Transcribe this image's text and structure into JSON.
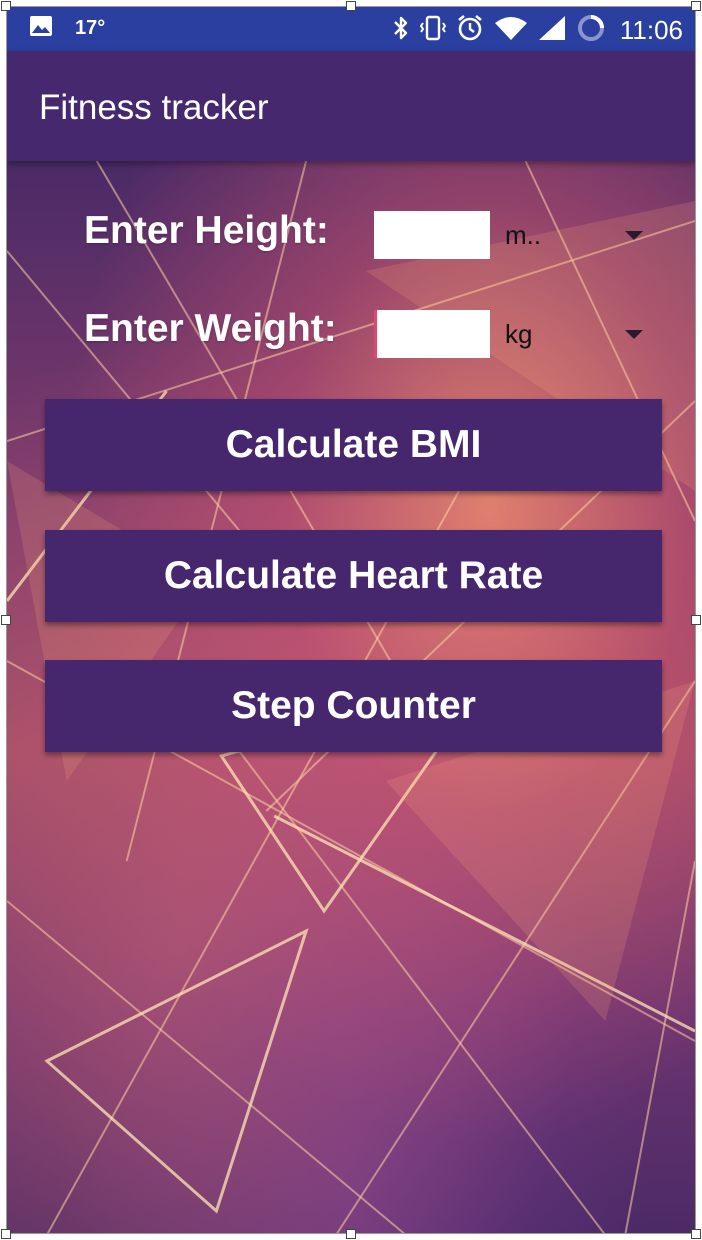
{
  "status_bar": {
    "temperature": "17°",
    "time": "11:06",
    "icons": [
      "image-icon",
      "bluetooth-icon",
      "vibrate-icon",
      "alarm-icon",
      "wifi-icon",
      "cell-signal-icon",
      "battery-icon"
    ]
  },
  "app_bar": {
    "title": "Fitness tracker"
  },
  "form": {
    "height": {
      "label": "Enter Height:",
      "value": "",
      "unit": "m.."
    },
    "weight": {
      "label": "Enter Weight:",
      "value": "",
      "unit": "kg"
    }
  },
  "buttons": {
    "bmi": "Calculate BMI",
    "heart_rate": "Calculate Heart Rate",
    "step_counter": "Step Counter"
  },
  "colors": {
    "status_bar": "#2a3fa0",
    "app_bar": "#46286f",
    "button": "#46276e",
    "focus_accent": "#e5446e"
  }
}
